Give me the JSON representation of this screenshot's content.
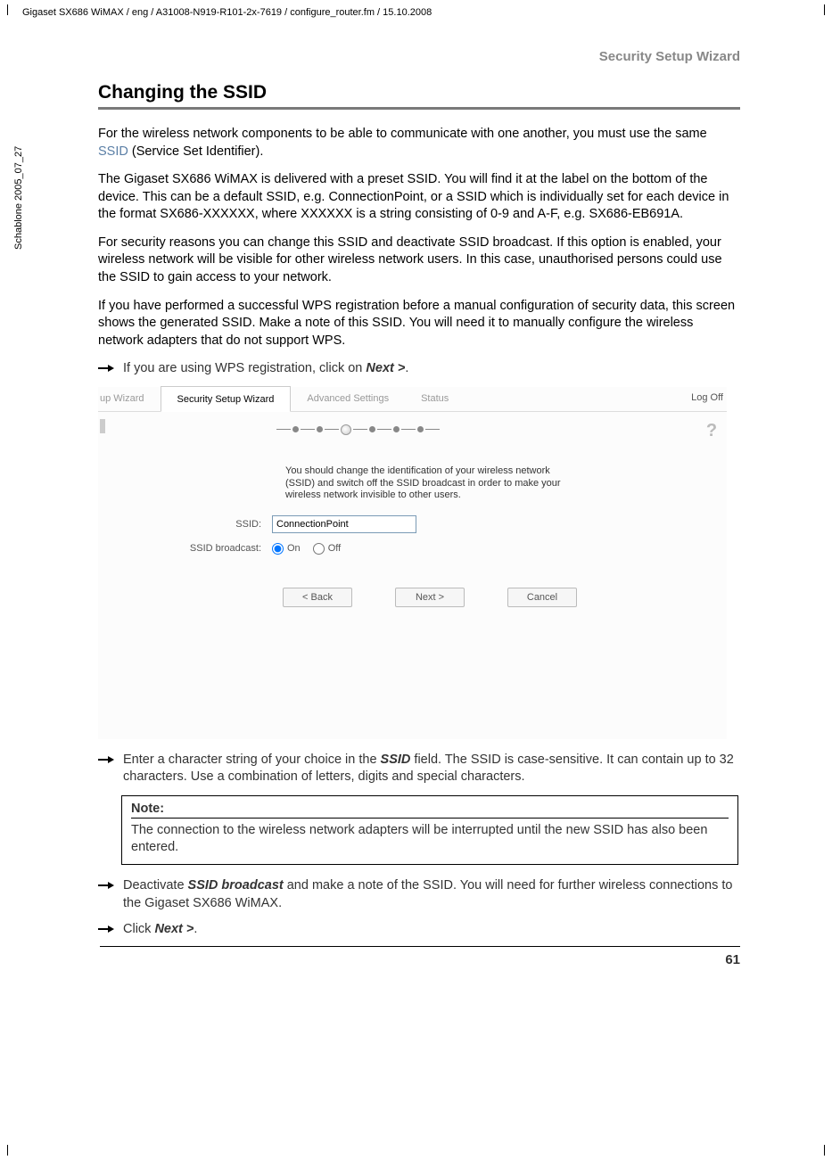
{
  "meta": {
    "headerLine": "Gigaset SX686 WiMAX / eng / A31008-N919-R101-2x-7619 / configure_router.fm / 15.10.2008",
    "sideText": "Schablone 2005_07_27"
  },
  "page": {
    "sectionHeader": "Security Setup Wizard",
    "title": "Changing the SSID",
    "p1_a": "For the wireless network components to be able to communicate with one another, you must use the same ",
    "p1_link": "SSID",
    "p1_b": " (Service Set Identifier).",
    "p2": "The Gigaset SX686 WiMAX is delivered with a preset SSID. You will find it at the label on the bottom of the device. This can be a default SSID, e.g. ConnectionPoint, or a SSID which is individually set for each device in the format SX686-XXXXXX, where XXXXXX is a string consisting of 0-9 and A-F, e.g. SX686-EB691A.",
    "p3": "For security reasons you can change this SSID and deactivate SSID broadcast. If this option is enabled, your wireless network will be visible for other wireless network users. In this case, unauthorised persons could use the SSID to gain access to your network.",
    "p4": "If you have performed a successful WPS registration before a manual configuration of security data, this screen shows the generated SSID. Make a note of this SSID. You will need it to manually configure the wireless network adapters that do not support WPS.",
    "arrow1_a": "If you are using WPS registration, click on ",
    "arrow1_b": "Next >",
    "arrow1_c": ".",
    "arrow2_a": "Enter a character string of your choice in the ",
    "arrow2_b": "SSID",
    "arrow2_c": " field. The SSID is case-sensitive. It can contain up to 32 characters. Use a combination of letters, digits and special characters.",
    "noteTitle": "Note:",
    "noteBody": "The connection to the wireless network adapters will be interrupted until the new SSID has also been entered.",
    "arrow3_a": "Deactivate ",
    "arrow3_b": "SSID broadcast",
    "arrow3_c": " and make a note of the SSID. You will need for further wireless connections to the Gigaset SX686 WiMAX.",
    "arrow4_a": "Click ",
    "arrow4_b": "Next >",
    "arrow4_c": ".",
    "pageNumber": "61"
  },
  "wizard": {
    "tabs": {
      "partial": "up Wizard",
      "active": "Security Setup Wizard",
      "advanced": "Advanced Settings",
      "status": "Status"
    },
    "logoff": "Log Off",
    "helpIcon": "?",
    "instruction": "You should change the identification of your wireless network (SSID) and switch off the SSID broadcast in order to make your wireless network invisible to other users.",
    "labelSSID": "SSID:",
    "ssidValue": "ConnectionPoint",
    "labelBroadcast": "SSID broadcast:",
    "radioOn": "On",
    "radioOff": "Off",
    "btnBack": "< Back",
    "btnNext": "Next >",
    "btnCancel": "Cancel"
  }
}
